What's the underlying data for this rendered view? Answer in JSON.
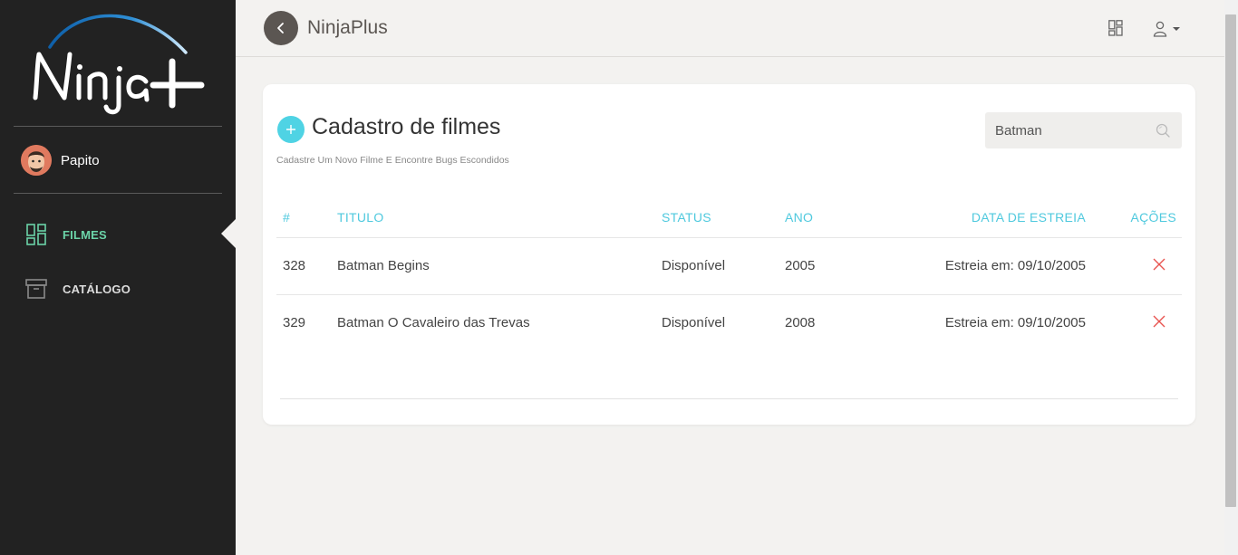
{
  "brand": {
    "logo_text": "Ninja+",
    "app_title": "NinjaPlus"
  },
  "user": {
    "name": "Papito"
  },
  "sidebar": {
    "items": [
      {
        "label": "FILMES",
        "icon": "dashboard-icon",
        "active": true
      },
      {
        "label": "CATÁLOGO",
        "icon": "archive-icon",
        "active": false
      }
    ]
  },
  "page": {
    "title": "Cadastro de filmes",
    "subtitle": "Cadastre Um Novo Filme E Encontre Bugs Escondidos"
  },
  "search": {
    "value": "Batman"
  },
  "table": {
    "headers": {
      "id": "#",
      "title": "TITULO",
      "status": "STATUS",
      "year": "ANO",
      "release": "DATA DE ESTREIA",
      "actions": "AÇÕES"
    },
    "rows": [
      {
        "id": "328",
        "title": "Batman Begins",
        "status": "Disponível",
        "year": "2005",
        "release": "Estreia em: 09/10/2005"
      },
      {
        "id": "329",
        "title": "Batman O Cavaleiro das Trevas",
        "status": "Disponível",
        "year": "2008",
        "release": "Estreia em: 09/10/2005"
      }
    ]
  },
  "colors": {
    "sidebar_bg": "#222222",
    "accent_green": "#6bd3a8",
    "accent_cyan": "#4fc9de",
    "delete_red": "#e8534f",
    "page_bg": "#f3f2f0"
  }
}
